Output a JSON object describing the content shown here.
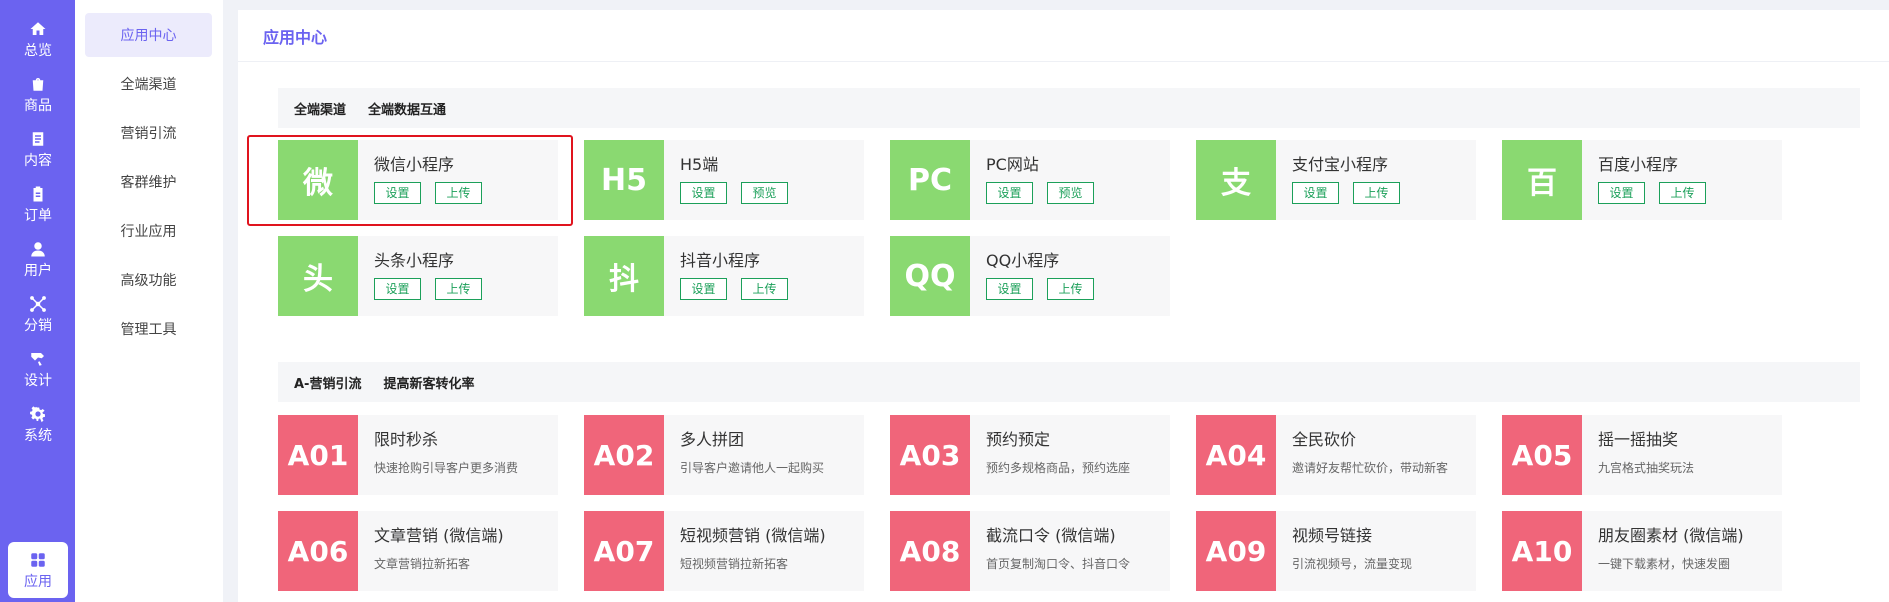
{
  "rail": [
    {
      "label": "总览",
      "icon": "home-icon"
    },
    {
      "label": "商品",
      "icon": "bag-icon"
    },
    {
      "label": "内容",
      "icon": "document-icon"
    },
    {
      "label": "订单",
      "icon": "clipboard-icon"
    },
    {
      "label": "用户",
      "icon": "user-icon"
    },
    {
      "label": "分销",
      "icon": "network-icon"
    },
    {
      "label": "设计",
      "icon": "brush-icon"
    },
    {
      "label": "系统",
      "icon": "gear-icon"
    },
    {
      "label": "应用",
      "icon": "grid-icon",
      "active": true
    }
  ],
  "submenu": [
    "应用中心",
    "全端渠道",
    "营销引流",
    "客群维护",
    "行业应用",
    "高级功能",
    "管理工具"
  ],
  "panel": {
    "title": "应用中心"
  },
  "sections": {
    "channels": {
      "name": "全端渠道",
      "desc": "全端数据互通"
    },
    "marketing": {
      "name": "A-营销引流",
      "desc": "提高新客转化率"
    }
  },
  "channels": [
    {
      "badge": "微",
      "name": "微信小程序",
      "btn1": "设置",
      "btn2": "上传"
    },
    {
      "badge": "H5",
      "name": "H5端",
      "btn1": "设置",
      "btn2": "预览"
    },
    {
      "badge": "PC",
      "name": "PC网站",
      "btn1": "设置",
      "btn2": "预览"
    },
    {
      "badge": "支",
      "name": "支付宝小程序",
      "btn1": "设置",
      "btn2": "上传"
    },
    {
      "badge": "百",
      "name": "百度小程序",
      "btn1": "设置",
      "btn2": "上传"
    },
    {
      "badge": "头",
      "name": "头条小程序",
      "btn1": "设置",
      "btn2": "上传"
    },
    {
      "badge": "抖",
      "name": "抖音小程序",
      "btn1": "设置",
      "btn2": "上传"
    },
    {
      "badge": "QQ",
      "name": "QQ小程序",
      "btn1": "设置",
      "btn2": "上传"
    }
  ],
  "marketing": [
    {
      "badge": "A01",
      "name": "限时秒杀",
      "desc": "快速抢购引导客户更多消费"
    },
    {
      "badge": "A02",
      "name": "多人拼团",
      "desc": "引导客户邀请他人一起购买"
    },
    {
      "badge": "A03",
      "name": "预约预定",
      "desc": "预约多规格商品，预约选座"
    },
    {
      "badge": "A04",
      "name": "全民砍价",
      "desc": "邀请好友帮忙砍价，带动新客"
    },
    {
      "badge": "A05",
      "name": "摇一摇抽奖",
      "desc": "九宫格式抽奖玩法"
    },
    {
      "badge": "A06",
      "name": "文章营销 (微信端)",
      "desc": "文章营销拉新拓客"
    },
    {
      "badge": "A07",
      "name": "短视频营销 (微信端)",
      "desc": "短视频营销拉新拓客"
    },
    {
      "badge": "A08",
      "name": "截流口令 (微信端)",
      "desc": "首页复制淘口令、抖音口令"
    },
    {
      "badge": "A09",
      "name": "视频号链接",
      "desc": "引流视频号，流量变现"
    },
    {
      "badge": "A10",
      "name": "朋友圈素材 (微信端)",
      "desc": "一键下载素材，快速发圈"
    }
  ],
  "colors": {
    "accent": "#6b63f0",
    "channel_badge": "#8ad971",
    "marketing_badge": "#f0657a",
    "button": "#1ca05a",
    "highlight": "#e0141e"
  }
}
